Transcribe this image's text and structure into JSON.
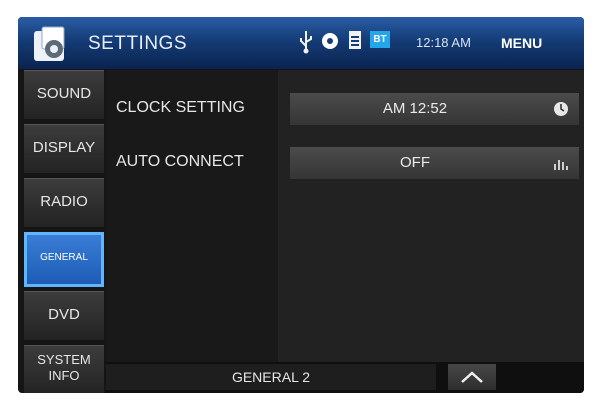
{
  "header": {
    "title": "SETTINGS",
    "time": "12:18 AM",
    "menu_label": "MENU",
    "status_icons": [
      "usb-icon",
      "disc-icon",
      "document-icon",
      "bluetooth-icon"
    ],
    "bt_label": "BT"
  },
  "sidebar": {
    "items": [
      {
        "label": "SOUND"
      },
      {
        "label": "DISPLAY"
      },
      {
        "label": "RADIO"
      },
      {
        "label": "GENERAL"
      },
      {
        "label": "DVD"
      },
      {
        "label1": "SYSTEM",
        "label2": "INFO"
      }
    ],
    "active": "GENERAL"
  },
  "settings": {
    "rows": [
      {
        "label": "CLOCK SETTING",
        "value": "AM 12:52",
        "icon": "clock-icon"
      },
      {
        "label": "AUTO CONNECT",
        "value": "OFF",
        "icon": "equalizer-icon"
      }
    ]
  },
  "footer": {
    "page_label": "GENERAL 2"
  },
  "colors": {
    "header_blue": "#143c76",
    "active_blue": "#2f6fc8",
    "bt_blue": "#23a6ea",
    "background": "#151515"
  }
}
